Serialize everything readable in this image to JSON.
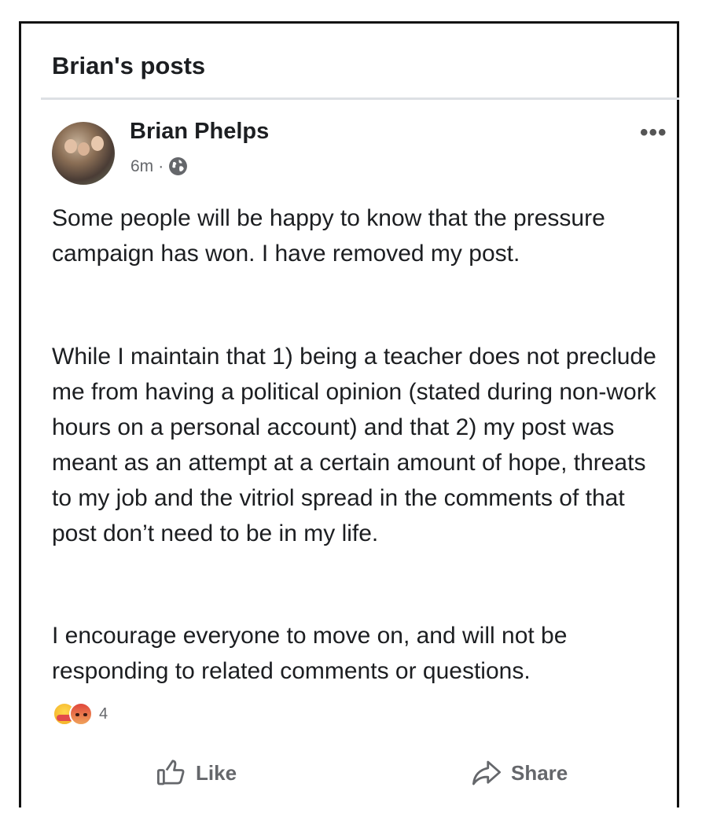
{
  "section": {
    "title": "Brian's posts"
  },
  "post": {
    "author": "Brian Phelps",
    "timestamp": "6m",
    "separator": "·",
    "audience_icon": "globe-icon",
    "more_label": "•••",
    "paragraphs": [
      "Some people will be happy to know that the pressure campaign has won.  I have removed my post.",
      "While I maintain that 1) being a teacher does not preclude me from having a political opinion (stated during non-work hours on a personal account) and that 2) my post was meant as an attempt at a certain amount of hope, threats to my job and the vitriol spread in the comments of that post don’t need to be in my life.",
      "I encourage everyone to move on, and will not be responding to related comments or questions."
    ],
    "reactions": {
      "icons": [
        "care-emoji-icon",
        "angry-emoji-icon"
      ],
      "count": "4"
    }
  },
  "actions": {
    "like_label": "Like",
    "share_label": "Share"
  },
  "colors": {
    "text": "#1c1e21",
    "secondary": "#65676b",
    "divider": "#dde0e4"
  }
}
